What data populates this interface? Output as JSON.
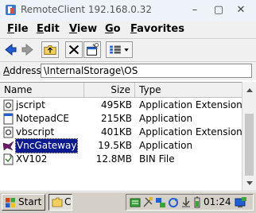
{
  "window": {
    "title": "RemoteClient 192.168.0.32",
    "min_glyph": "–",
    "max_glyph": "▢",
    "close_glyph": "✕"
  },
  "menu": {
    "items": [
      {
        "underline": "F",
        "rest": "ile"
      },
      {
        "underline": "E",
        "rest": "dit"
      },
      {
        "underline": "V",
        "rest": "iew"
      },
      {
        "underline": "G",
        "rest": "o"
      },
      {
        "underline": "F",
        "rest": "avorites"
      }
    ]
  },
  "toolbar": {
    "icons": [
      "back-arrow-icon",
      "forward-arrow-icon",
      "up-folder-icon",
      "delete-icon",
      "properties-icon",
      "view-mode-icon",
      "dropdown-arrow-icon"
    ]
  },
  "address": {
    "label": "Address",
    "value": "\\InternalStorage\\OS"
  },
  "columns": {
    "name": "Name",
    "size": "Size",
    "type": "Type"
  },
  "files": [
    {
      "name": "jscript",
      "size": "495KB",
      "type": "Application Extension",
      "icon": "dll-icon"
    },
    {
      "name": "NotepadCE",
      "size": "215KB",
      "type": "Application",
      "icon": "exe-icon"
    },
    {
      "name": "vbscript",
      "size": "401KB",
      "type": "Application Extension",
      "icon": "dll-icon"
    },
    {
      "name": "VncGateway",
      "size": "19.5KB",
      "type": "Application",
      "icon": "vnc-app-icon",
      "selected": true
    },
    {
      "name": "XV102",
      "size": "12.8MB",
      "type": "BIN File",
      "icon": "bin-file-icon"
    }
  ],
  "taskbar": {
    "start_label": "Start",
    "task_label": "C",
    "clock": "01:24"
  },
  "colors": {
    "selection": "#0b1a8f",
    "start_flag": [
      "#e03c1c",
      "#3aa63a",
      "#1f5fd6",
      "#f2c21b"
    ]
  }
}
